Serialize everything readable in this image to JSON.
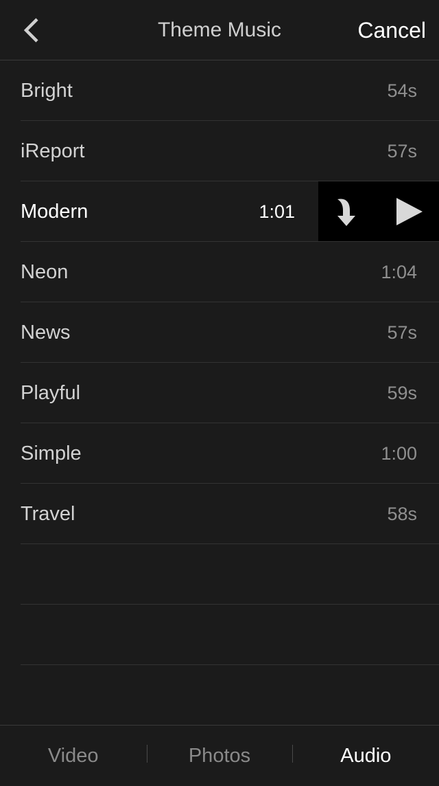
{
  "nav": {
    "title": "Theme Music",
    "cancel_label": "Cancel",
    "back_icon": "chevron-left-icon"
  },
  "tracks": [
    {
      "name": "Bright",
      "duration": "54s"
    },
    {
      "name": "iReport",
      "duration": "57s"
    },
    {
      "name": "Modern",
      "duration": "1:01",
      "selected": true
    },
    {
      "name": "Neon",
      "duration": "1:04"
    },
    {
      "name": "News",
      "duration": "57s"
    },
    {
      "name": "Playful",
      "duration": "59s"
    },
    {
      "name": "Simple",
      "duration": "1:00"
    },
    {
      "name": "Travel",
      "duration": "58s"
    }
  ],
  "row_actions": {
    "use_icon": "curved-arrow-down-icon",
    "play_icon": "play-icon"
  },
  "tabs": [
    {
      "label": "Video",
      "active": false
    },
    {
      "label": "Photos",
      "active": false
    },
    {
      "label": "Audio",
      "active": true
    }
  ],
  "colors": {
    "background": "#1b1b1b",
    "text_primary": "#ffffff",
    "text_secondary": "#8f8f8f",
    "action_background": "#000000"
  }
}
